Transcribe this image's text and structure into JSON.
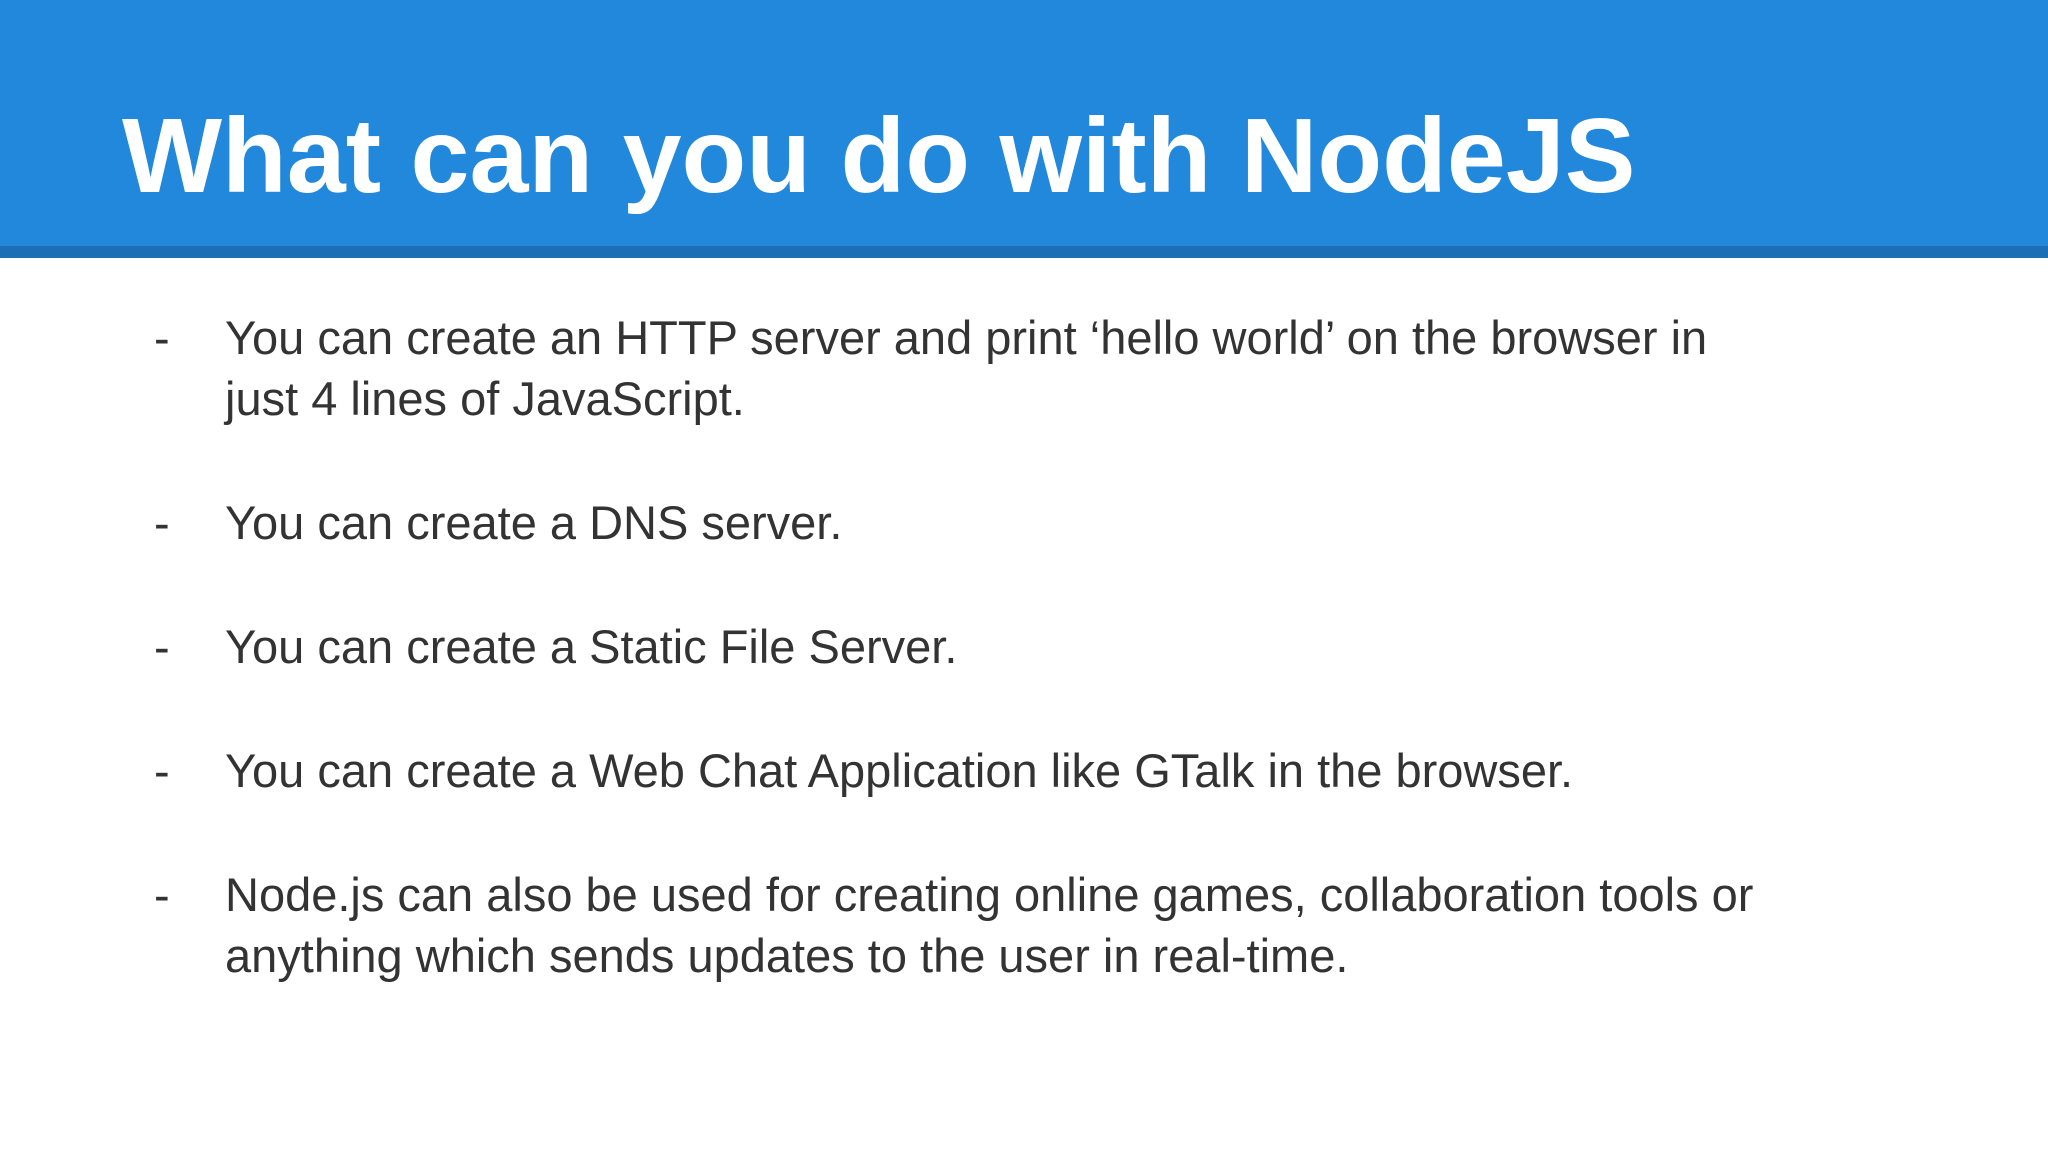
{
  "slide": {
    "title": "What can you do with NodeJS",
    "header_color": "#2288dc",
    "header_rule_color": "#1d6fb5",
    "text_color": "#333333",
    "bullet_marker": "-",
    "bullets": [
      {
        "lines": [
          "You can create an HTTP server and print ‘hello world’ on the browser in",
          "just 4 lines of JavaScript."
        ]
      },
      {
        "lines": [
          "You can create a DNS server."
        ]
      },
      {
        "lines": [
          "You can create a Static File Server."
        ]
      },
      {
        "lines": [
          "You can create a Web Chat Application like GTalk in the browser."
        ]
      },
      {
        "lines": [
          "Node.js can also be used for creating online games, collaboration tools or",
          "anything which sends updates to the user in real-time."
        ]
      }
    ]
  }
}
